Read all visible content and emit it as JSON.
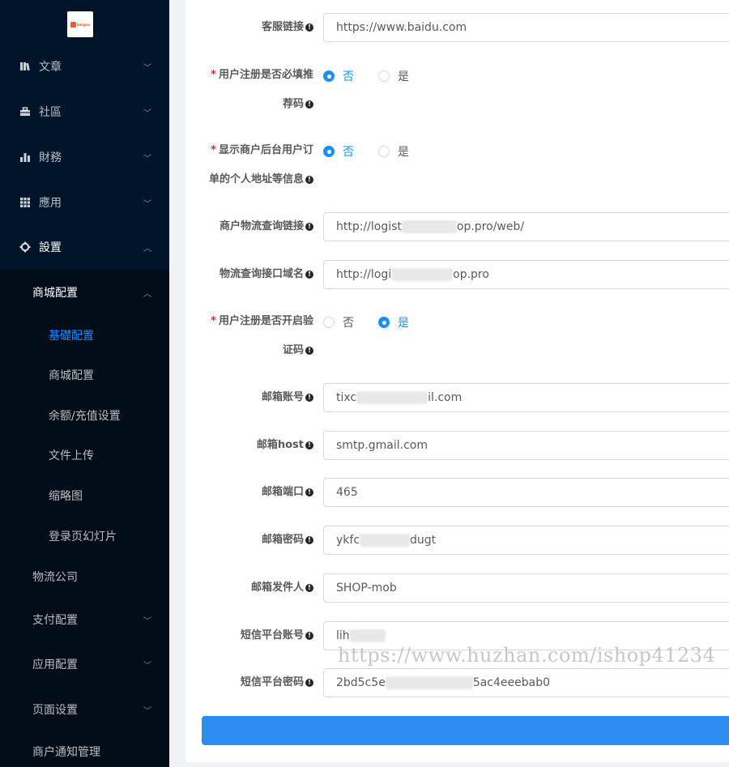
{
  "logo": {
    "text": "Swigou",
    "brand_color": "#ff5a1f"
  },
  "sidebar": {
    "items": [
      {
        "label": "文章",
        "icon": "book-icon"
      },
      {
        "label": "社區",
        "icon": "briefcase-icon"
      },
      {
        "label": "財務",
        "icon": "bar-chart-icon"
      },
      {
        "label": "應用",
        "icon": "grid-icon"
      },
      {
        "label": "設置",
        "icon": "gear-icon"
      }
    ],
    "settings_sub": [
      {
        "label": "商城配置"
      },
      {
        "label": "基礎配置"
      },
      {
        "label": "商城配置"
      },
      {
        "label": "余额/充值设置"
      },
      {
        "label": "文件上传"
      },
      {
        "label": "缩略图"
      },
      {
        "label": "登录页幻灯片"
      },
      {
        "label": "物流公司"
      },
      {
        "label": "支付配置"
      },
      {
        "label": "应用配置"
      },
      {
        "label": "页面设置"
      },
      {
        "label": "商户通知管理"
      }
    ]
  },
  "form": {
    "kefu": {
      "label": "客服链接",
      "value": "https://www.baidu.com"
    },
    "reg_recommend": {
      "label_1": "用户注册是否必填推",
      "label_2": "荐码",
      "opt_no": "否",
      "opt_yes": "是",
      "selected": "否"
    },
    "merchant_addr": {
      "label_1": "显示商户后台用户订",
      "label_2": "单的个人地址等信息",
      "opt_no": "否",
      "opt_yes": "是",
      "selected": "否"
    },
    "logistics_link": {
      "label": "商户物流查询链接",
      "value_pre": "http://logist",
      "value_post": "op.pro/web/"
    },
    "logistics_domain": {
      "label": "物流查询接口域名",
      "value_pre": "http://logi",
      "value_post": "op.pro"
    },
    "reg_captcha": {
      "label_1": "用户注册是否开启验",
      "label_2": "证码",
      "opt_no": "否",
      "opt_yes": "是",
      "selected": "是"
    },
    "mail_account": {
      "label": "邮箱账号",
      "value_pre": "tixc",
      "value_post": "il.com"
    },
    "mail_host": {
      "label": "邮箱host",
      "value": "smtp.gmail.com"
    },
    "mail_port": {
      "label": "邮箱端口",
      "value": "465"
    },
    "mail_password": {
      "label": "邮箱密码",
      "value_pre": "ykfc",
      "value_post": "dugt"
    },
    "mail_sender": {
      "label": "邮箱发件人",
      "value": "SHOP-mob"
    },
    "sms_account": {
      "label": "短信平台账号",
      "value_pre": "lih",
      "value_post": ""
    },
    "sms_password": {
      "label": "短信平台密码",
      "value_pre": "2bd5c5e",
      "value_post": "5ac4eeebab0"
    }
  },
  "watermark": "https://www.huzhan.com/ishop41234",
  "colors": {
    "primary": "#1890ff",
    "sidebar_bg": "#001529",
    "submenu_bg": "#000c17",
    "submit": "#2d8cf0",
    "required": "#f5222d"
  }
}
